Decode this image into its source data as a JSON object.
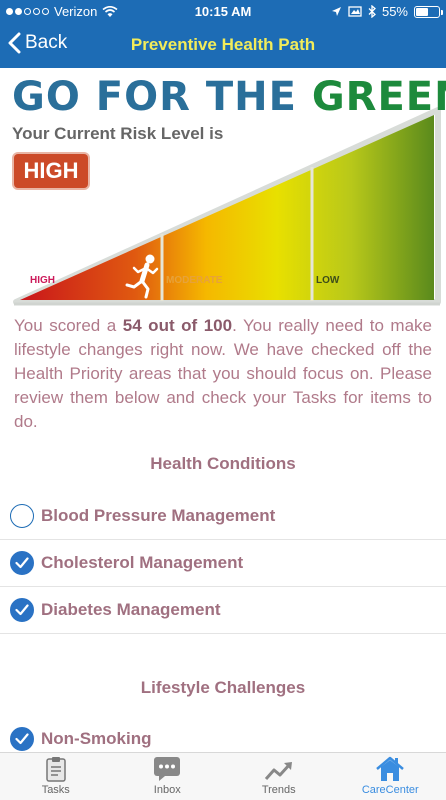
{
  "status": {
    "carrier": "Verizon",
    "time": "10:15 AM",
    "battery": "55%",
    "battery_level": 0.55,
    "signal_bars": 2
  },
  "nav": {
    "back_label": "Back",
    "title": "Preventive Health Path"
  },
  "hero": {
    "headline_part1": "GO FOR THE",
    "headline_part2": "GREEN",
    "risk_label": "Your Current Risk Level is",
    "risk_value": "HIGH",
    "meter_labels": {
      "high": "HIGH",
      "moderate": "MODERATE",
      "low": "LOW"
    }
  },
  "score": {
    "prefix": "You scored a ",
    "score_text": "54 out of 100",
    "suffix": ". You really need to make lifestyle changes right now. We have checked off the Health Priority areas that you should focus on. Please review them below and check your Tasks for items to do."
  },
  "health_conditions": {
    "title": "Health Conditions",
    "items": [
      {
        "label": "Blood Pressure Management",
        "checked": false
      },
      {
        "label": "Cholesterol Management",
        "checked": true
      },
      {
        "label": "Diabetes Management",
        "checked": true
      }
    ]
  },
  "lifestyle": {
    "title": "Lifestyle Challenges",
    "items": [
      {
        "label": "Non-Smoking",
        "checked": true
      }
    ]
  },
  "tabbar": {
    "tasks": "Tasks",
    "inbox": "Inbox",
    "trends": "Trends",
    "carecenter": "CareCenter"
  },
  "colors": {
    "nav_bg": "#1d6cb5",
    "title_yellow": "#f2ec5a",
    "badge_red": "#cc4a28",
    "accent_blue": "#3a8de0"
  },
  "icons": [
    "back-chevron-icon",
    "wifi-icon",
    "location-icon",
    "screen-rotation-icon",
    "bluetooth-icon",
    "battery-icon",
    "runner-icon",
    "checkmark-icon",
    "clipboard-icon",
    "chat-icon",
    "trend-icon",
    "home-icon"
  ]
}
